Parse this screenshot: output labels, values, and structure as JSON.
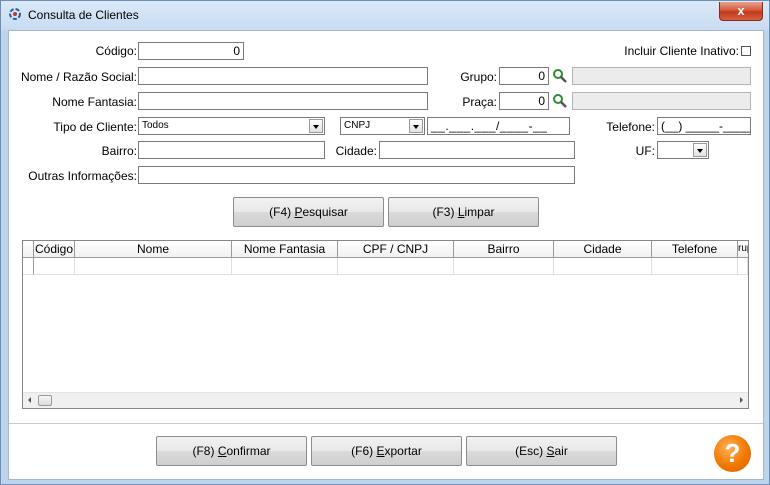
{
  "window": {
    "title": "Consulta de Clientes",
    "close_label": "x"
  },
  "form": {
    "codigo": {
      "label": "Código:",
      "value": "0"
    },
    "incluir_inativo": {
      "label": "Incluir Cliente Inativo:",
      "checked": false
    },
    "nome": {
      "label": "Nome / Razão Social:",
      "value": ""
    },
    "grupo": {
      "label": "Grupo:",
      "value": "0",
      "desc": ""
    },
    "nome_fantasia": {
      "label": "Nome Fantasia:",
      "value": ""
    },
    "praca": {
      "label": "Praça:",
      "value": "0",
      "desc": ""
    },
    "tipo_cliente": {
      "label": "Tipo de Cliente:",
      "selected": "Todos"
    },
    "documento": {
      "selected": "CNPJ",
      "mask": "__.___.___/____-__"
    },
    "telefone": {
      "label": "Telefone:",
      "mask": "(__) _____-____"
    },
    "bairro": {
      "label": "Bairro:",
      "value": ""
    },
    "cidade": {
      "label": "Cidade:",
      "value": ""
    },
    "uf": {
      "label": "UF:",
      "selected": ""
    },
    "outras": {
      "label": "Outras Informações:",
      "value": ""
    }
  },
  "actions": {
    "pesquisar": {
      "prefix": "(F4) ",
      "accel": "P",
      "rest": "esquisar"
    },
    "limpar": {
      "prefix": "(F3) ",
      "accel": "L",
      "rest": "impar"
    }
  },
  "grid": {
    "columns": [
      "Código",
      "Nome",
      "Nome Fantasia",
      "CPF / CNPJ",
      "Bairro",
      "Cidade",
      "Telefone",
      "rup"
    ]
  },
  "footer": {
    "confirmar": {
      "prefix": "(F8) ",
      "accel": "C",
      "rest": "onfirmar"
    },
    "exportar": {
      "prefix": "(F6) ",
      "accel": "E",
      "rest": "xportar"
    },
    "sair": {
      "prefix": "(Esc) ",
      "accel": "S",
      "rest": "air"
    },
    "help": "?"
  },
  "colors": {
    "help_orange": "#f07800",
    "close_red": "#c2381c"
  }
}
